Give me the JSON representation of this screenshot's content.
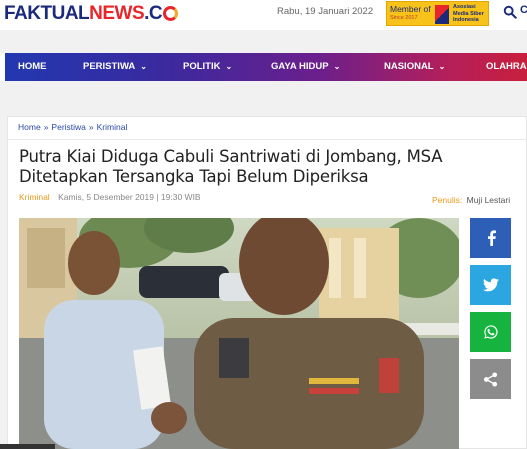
{
  "header": {
    "logo": {
      "part1": "FAKTUAL",
      "part2": "NEWS",
      "part3": ".C"
    },
    "date": "Rabu, 19 Januari 2022",
    "member_badge": {
      "member_of": "Member of",
      "since": "Since 2017",
      "org": "Asosiasi Media Siber Indonesia"
    },
    "search_icon": "search-icon",
    "edge_text": "C"
  },
  "nav": {
    "items": [
      {
        "label": "HOME",
        "has_dropdown": false
      },
      {
        "label": "PERISTIWA",
        "has_dropdown": true
      },
      {
        "label": "POLITIK",
        "has_dropdown": true
      },
      {
        "label": "GAYA HIDUP",
        "has_dropdown": true
      },
      {
        "label": "NASIONAL",
        "has_dropdown": true
      },
      {
        "label": "OLAHRAG",
        "has_dropdown": false
      }
    ],
    "chevron": "⌄"
  },
  "breadcrumb": {
    "items": [
      "Home",
      "Peristiwa",
      "Kriminal"
    ],
    "separator": "»"
  },
  "article": {
    "title": "Putra Kiai Diduga Cabuli Santriwati di Jombang, MSA Ditetapkan Tersangka Tapi Belum Diperiksa",
    "category": "Kriminal",
    "datetime": "Kamis, 5 Desember 2019 | 19:30 WIB",
    "author_label": "Penulis:",
    "author_name": "Muji Lestari"
  },
  "share": [
    {
      "name": "facebook",
      "icon": "facebook-icon",
      "color": "#2e5fb7"
    },
    {
      "name": "twitter",
      "icon": "twitter-icon",
      "color": "#2ba6e0"
    },
    {
      "name": "whatsapp",
      "icon": "whatsapp-icon",
      "color": "#16b43e"
    },
    {
      "name": "share",
      "icon": "share-icon",
      "color": "#8c8c8c"
    }
  ],
  "colors": {
    "brand_blue": "#1b2a7a",
    "brand_red": "#e8252b",
    "category_orange": "#e79a1a",
    "link_blue": "#2c4aa8"
  }
}
